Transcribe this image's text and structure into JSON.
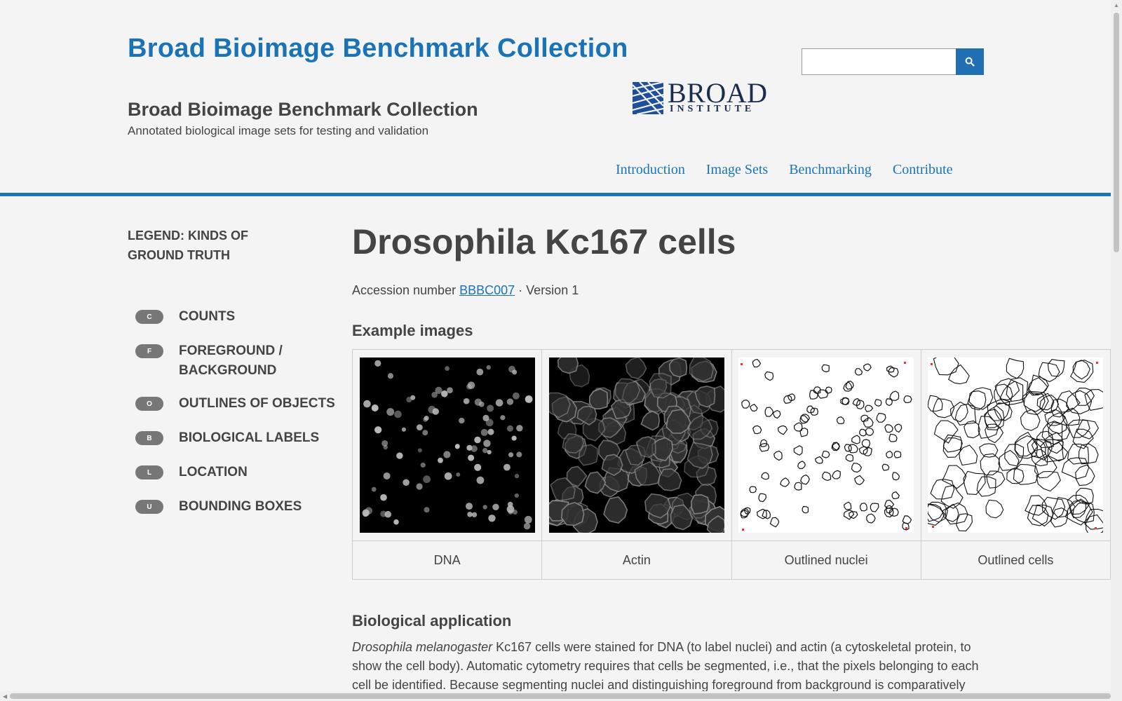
{
  "header": {
    "site_title": "Broad Bioimage Benchmark Collection",
    "site_name": "Broad Bioimage Benchmark Collection",
    "tagline": "Annotated biological image sets for testing and validation",
    "logo_line1": "BROAD",
    "logo_line2": "INSTITUTE",
    "search_placeholder": "",
    "nav": [
      "Introduction",
      "Image Sets",
      "Benchmarking",
      "Contribute"
    ],
    "accent_color": "#1a73b6"
  },
  "legend": {
    "title": "LEGEND: KINDS OF GROUND TRUTH",
    "items": [
      {
        "badge": "C",
        "label": "COUNTS"
      },
      {
        "badge": "F",
        "label": "FOREGROUND / BACKGROUND"
      },
      {
        "badge": "O",
        "label": "OUTLINES OF OBJECTS"
      },
      {
        "badge": "B",
        "label": "BIOLOGICAL LABELS"
      },
      {
        "badge": "L",
        "label": "LOCATION"
      },
      {
        "badge": "U",
        "label": "BOUNDING BOXES"
      }
    ]
  },
  "main": {
    "title": "Drosophila Kc167 cells",
    "accession_prefix": "Accession number",
    "accession_id": "BBBC007",
    "version_text": "· Version 1",
    "examples_heading": "Example images",
    "examples": [
      {
        "caption": "DNA",
        "icon": "dna-fluorescence-image"
      },
      {
        "caption": "Actin",
        "icon": "actin-fluorescence-image"
      },
      {
        "caption": "Outlined nuclei",
        "icon": "outlined-nuclei-image"
      },
      {
        "caption": "Outlined cells",
        "icon": "outlined-cells-image"
      }
    ],
    "bio_heading": "Biological application",
    "bio_italic": "Drosophila melanogaster",
    "bio_text": " Kc167 cells were stained for DNA (to label nuclei) and actin (a cytoskeletal protein, to show the cell body). Automatic cytometry requires that cells be segmented, i.e., that the pixels belonging to each cell be identified. Because segmenting nuclei and distinguishing foreground from background is comparatively"
  }
}
